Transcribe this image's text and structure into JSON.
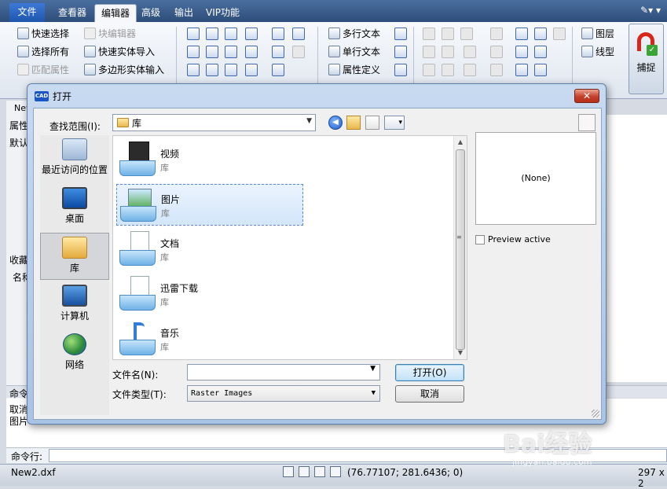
{
  "menubar": {
    "file": "文件",
    "tabs": [
      "查看器",
      "编辑器",
      "高级",
      "输出",
      "VIP功能"
    ],
    "active_tab": "编辑器"
  },
  "ribbon": {
    "group1": {
      "quick_select": "快速选择",
      "select_all": "选择所有",
      "match_props": "匹配属性",
      "block_editor": "块编辑器",
      "quick_import": "快速实体导入",
      "polygon_input": "多边形实体输入"
    },
    "text_group": {
      "mtext": "多行文本",
      "stext": "单行文本",
      "attdef": "属性定义"
    },
    "layer_group": {
      "layer": "图层",
      "linetype": "线型"
    },
    "snap": "捕捉"
  },
  "background": {
    "tab_label": "New",
    "props_label": "属性",
    "default_label": "默认",
    "fav_label": "收藏",
    "name_label": "名称",
    "cmd_label": "命令",
    "cmd_line1": "取消",
    "cmd_line2": "图片",
    "cmd_prompt": "命令行:"
  },
  "statusbar": {
    "filename": "New2.dxf",
    "coords": "(76.77107; 281.6436; 0)",
    "size": "297 x 2"
  },
  "dialog": {
    "title": "打开",
    "badge": "CAD",
    "close": "✕",
    "look_in_label": "查找范围(I):",
    "look_in_value": "库",
    "places": [
      {
        "label": "最近访问的位置"
      },
      {
        "label": "桌面"
      },
      {
        "label": "库"
      },
      {
        "label": "计算机"
      },
      {
        "label": "网络"
      }
    ],
    "items": [
      {
        "name": "视频",
        "type": "库"
      },
      {
        "name": "图片",
        "type": "库"
      },
      {
        "name": "文档",
        "type": "库"
      },
      {
        "name": "迅雷下载",
        "type": "库"
      },
      {
        "name": "音乐",
        "type": "库"
      }
    ],
    "preview_text": "(None)",
    "preview_active": "Preview active",
    "file_name_label": "文件名(N):",
    "file_name_value": "",
    "file_type_label": "文件类型(T):",
    "file_type_value": "Raster Images",
    "open_button": "打开(O)",
    "cancel_button": "取消"
  },
  "watermark": {
    "main": "Bai经验",
    "sub": "jingyan.baidu.com"
  }
}
